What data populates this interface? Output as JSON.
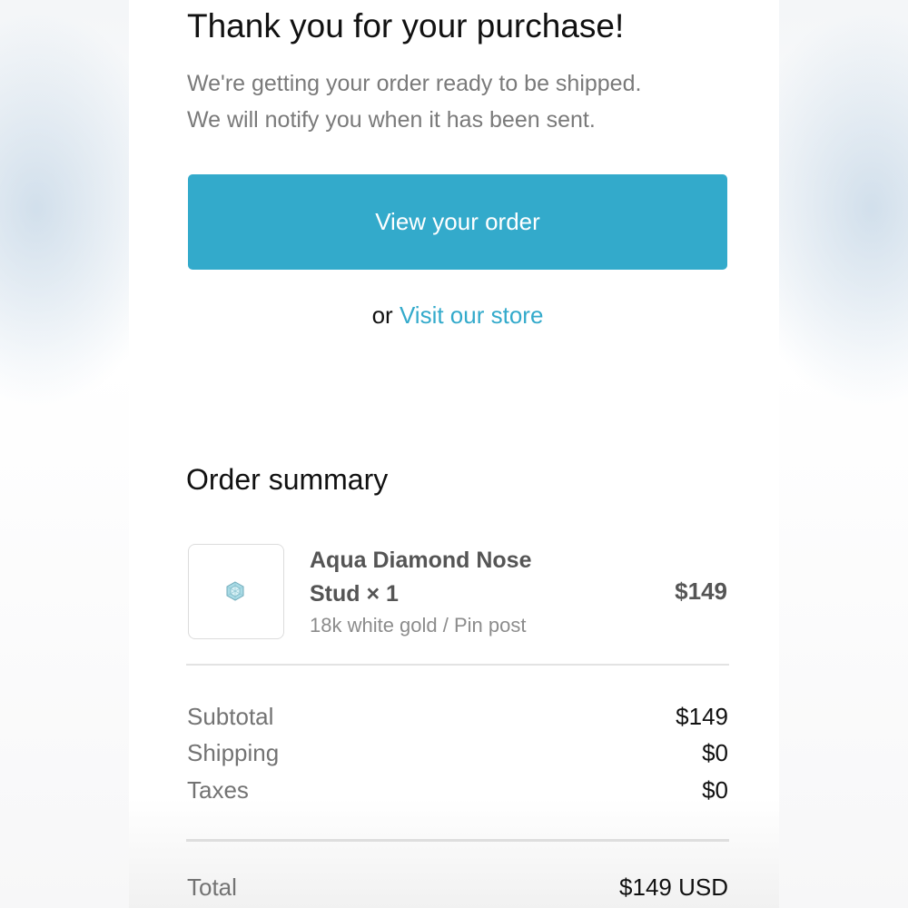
{
  "header": {
    "title": "Thank you for your purchase!",
    "message_line1": "We're getting your order ready to be shipped.",
    "message_line2": "We will notify you when it has been sent."
  },
  "actions": {
    "view_order_label": "View your order",
    "or_text": "or",
    "visit_store_label": "Visit our store"
  },
  "order_summary": {
    "title": "Order summary",
    "items": [
      {
        "thumbnail_icon": "aqua-diamond-stud-icon",
        "name_line1": "Aqua Diamond Nose",
        "name_line2": "Stud × 1",
        "variant": "18k white gold / Pin post",
        "price": "$149"
      }
    ],
    "rows": [
      {
        "label": "Subtotal",
        "value": "$149"
      },
      {
        "label": "Shipping",
        "value": "$0"
      },
      {
        "label": "Taxes",
        "value": "$0"
      }
    ],
    "total": {
      "label": "Total",
      "value": "$149 USD"
    }
  },
  "colors": {
    "accent": "#33aacb",
    "text_primary": "#111111",
    "text_secondary": "#7a7a7a"
  }
}
